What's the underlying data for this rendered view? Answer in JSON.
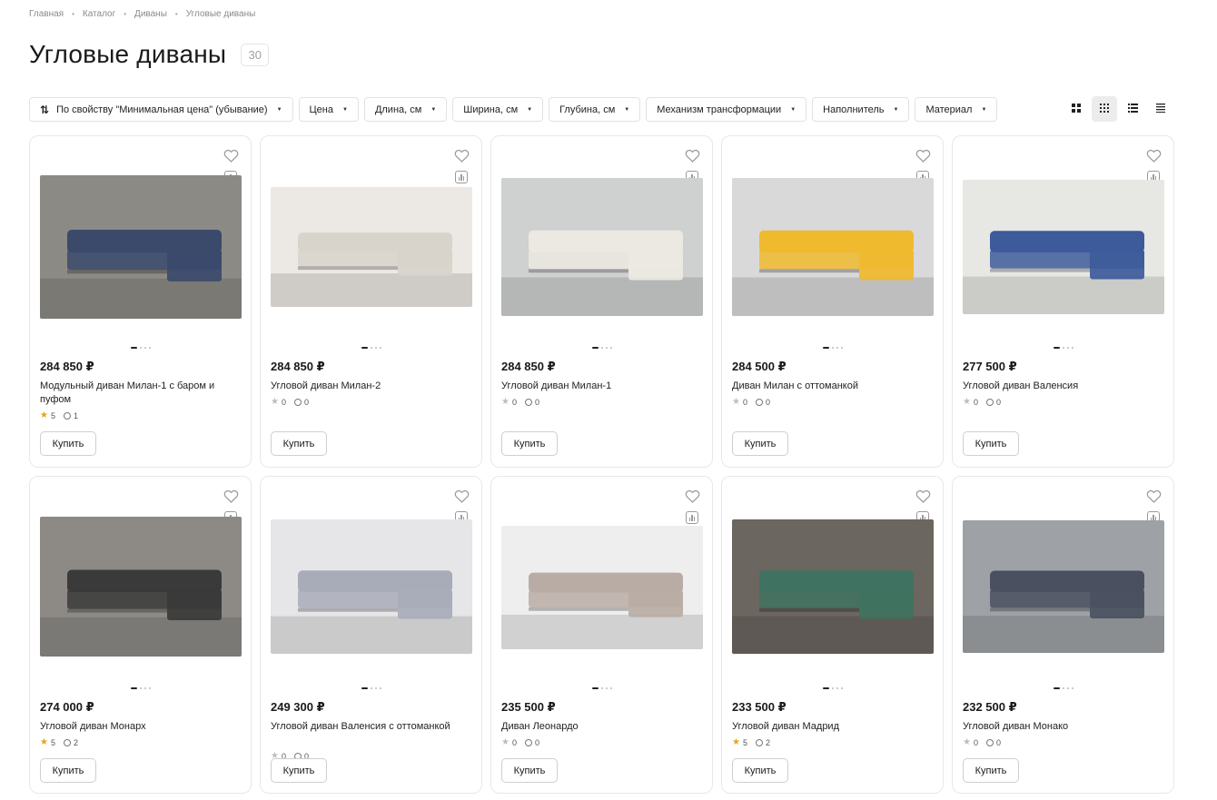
{
  "breadcrumb": [
    "Главная",
    "Каталог",
    "Диваны",
    "Угловые диваны"
  ],
  "page": {
    "title": "Угловые диваны",
    "count": "30"
  },
  "filters": [
    {
      "label": "По свойству \"Минимальная цена\" (убывание)",
      "icon": "sort-icon"
    },
    {
      "label": "Цена"
    },
    {
      "label": "Длина, см"
    },
    {
      "label": "Ширина, см"
    },
    {
      "label": "Глубина, см"
    },
    {
      "label": "Механизм трансформации"
    },
    {
      "label": "Наполнитель"
    },
    {
      "label": "Материал"
    }
  ],
  "views": [
    "grid-large-icon",
    "grid-small-icon",
    "list-icon",
    "compact-list-icon"
  ],
  "buy_label": "Купить",
  "products": [
    {
      "price": "284 850 ₽",
      "name": "Модульный диван Милан-1 с баром и пуфом",
      "rating": "5",
      "reviews": "1",
      "rated": true,
      "sofa_color": "#3b4a6b",
      "bg": "#8c8a84"
    },
    {
      "price": "284 850 ₽",
      "name": "Угловой диван Милан-2",
      "rating": "0",
      "reviews": "0",
      "rated": false,
      "sofa_color": "#d8d3cb",
      "bg": "#ece9e4"
    },
    {
      "price": "284 850 ₽",
      "name": "Угловой диван Милан-1",
      "rating": "0",
      "reviews": "0",
      "rated": false,
      "sofa_color": "#ece9e2",
      "bg": "#cfd0d0"
    },
    {
      "price": "284 500 ₽",
      "name": "Диван Милан с оттоманкой",
      "rating": "0",
      "reviews": "0",
      "rated": false,
      "sofa_color": "#efba2e",
      "bg": "#d9d9d9"
    },
    {
      "price": "277 500 ₽",
      "name": "Угловой диван Валенсия",
      "rating": "0",
      "reviews": "0",
      "rated": false,
      "sofa_color": "#3d5a9a",
      "bg": "#e7e7e4"
    },
    {
      "price": "274 000 ₽",
      "name": "Угловой диван Монарх",
      "rating": "5",
      "reviews": "2",
      "rated": true,
      "sofa_color": "#3a3a3a",
      "bg": "#8d8a86"
    },
    {
      "price": "249 300 ₽",
      "name": "Угловой диван Валенсия с оттоманкой",
      "rating": "0",
      "reviews": "0",
      "rated": false,
      "sofa_color": "#a8acb8",
      "bg": "#e6e6e8"
    },
    {
      "price": "235 500 ₽",
      "name": "Диван Леонардо",
      "rating": "0",
      "reviews": "0",
      "rated": false,
      "sofa_color": "#b8aca4",
      "bg": "#eeeeee"
    },
    {
      "price": "233 500 ₽",
      "name": "Угловой диван Мадрид",
      "rating": "5",
      "reviews": "2",
      "rated": true,
      "sofa_color": "#3f7260",
      "bg": "#6b6660"
    },
    {
      "price": "232 500 ₽",
      "name": "Угловой диван Монако",
      "rating": "0",
      "reviews": "0",
      "rated": false,
      "sofa_color": "#4a5060",
      "bg": "#9ea2a6"
    }
  ]
}
